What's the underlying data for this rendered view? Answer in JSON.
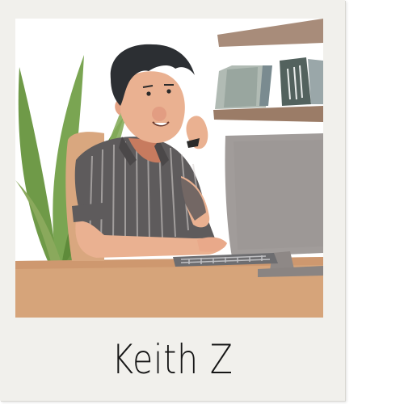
{
  "caption": {
    "name": "Keith Z"
  },
  "colors": {
    "frame": "#f1f0ec",
    "photo_bg": "#ffffff",
    "desk": "#d6a47a",
    "shirt": "#5e5b5c",
    "skin": "#eab191",
    "hair": "#2c2f33",
    "plant": "#6f9a48",
    "pot": "#4c5b8e",
    "monitor": "#a19c9a",
    "shelf": "#9e7f6b"
  },
  "icons": {
    "plant": "potted-plant-icon",
    "monitor": "monitor-icon",
    "keyboard": "keyboard-icon",
    "books": "book-icon"
  }
}
